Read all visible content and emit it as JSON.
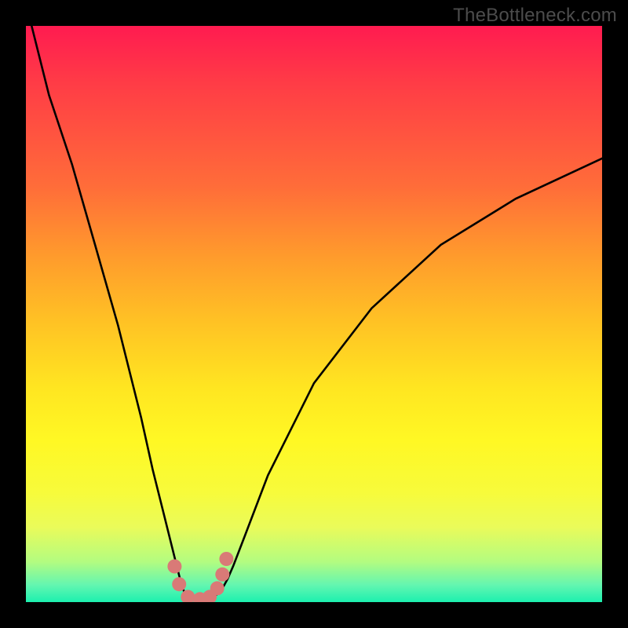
{
  "watermark": "TheBottleneck.com",
  "chart_data": {
    "type": "line",
    "title": "",
    "xlabel": "",
    "ylabel": "",
    "xlim": [
      0,
      100
    ],
    "ylim": [
      0,
      100
    ],
    "series": [
      {
        "name": "black-curve",
        "color": "#000000",
        "x": [
          1,
          4,
          8,
          12,
          16,
          20,
          22,
          24,
          26,
          27,
          27.7,
          28.5,
          30,
          31.5,
          33,
          34,
          35,
          36,
          38,
          42,
          50,
          60,
          72,
          85,
          100
        ],
        "y": [
          100,
          88,
          76,
          62,
          48,
          32,
          23,
          15,
          7,
          3,
          1.2,
          0.6,
          0.4,
          0.6,
          1.2,
          2.2,
          4,
          6.3,
          11.5,
          22,
          38,
          51,
          62,
          70,
          77
        ]
      },
      {
        "name": "salmon-dots",
        "color": "#d97a77",
        "x": [
          25.8,
          26.6,
          28.1,
          30.2,
          31.9,
          33.2,
          34.1,
          34.8
        ],
        "y": [
          6.2,
          3.1,
          0.9,
          0.5,
          0.9,
          2.4,
          4.8,
          7.5
        ]
      }
    ],
    "gradient_stops": [
      {
        "pos": 0,
        "color": "#ff1b50"
      },
      {
        "pos": 28,
        "color": "#ff6d39"
      },
      {
        "pos": 52,
        "color": "#ffc424"
      },
      {
        "pos": 72,
        "color": "#fff824"
      },
      {
        "pos": 100,
        "color": "#1cf0af"
      }
    ]
  }
}
